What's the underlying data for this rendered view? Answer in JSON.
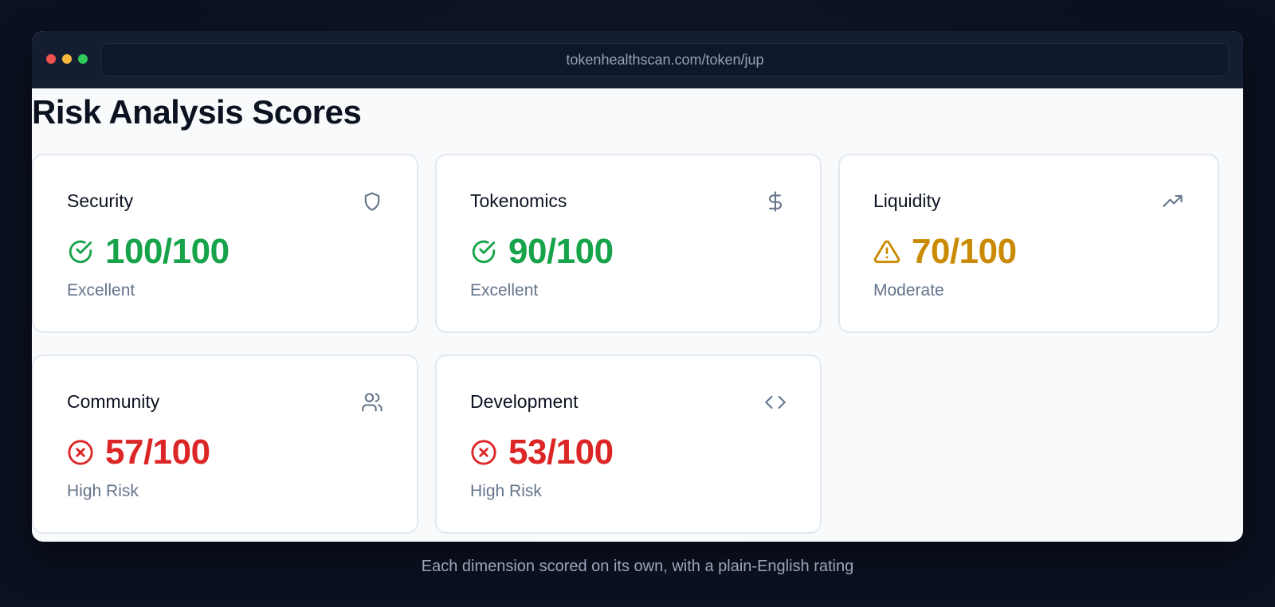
{
  "browser": {
    "url": "tokenhealthscan.com/token/jup",
    "dots": [
      "#ef4444",
      "#f59e0b",
      "#22c55e"
    ]
  },
  "page": {
    "title": "Risk Analysis Scores"
  },
  "colors": {
    "good": "#16a34a",
    "moderate": "#ca8a04",
    "risk": "#dc2626",
    "icon": "#64748b"
  },
  "cards": [
    {
      "title": "Security",
      "score": "100/100",
      "rating": "Excellent",
      "icon": "shield-icon",
      "status": "good"
    },
    {
      "title": "Tokenomics",
      "score": "90/100",
      "rating": "Excellent",
      "icon": "dollar-icon",
      "status": "good"
    },
    {
      "title": "Liquidity",
      "score": "70/100",
      "rating": "Moderate",
      "icon": "trending-up-icon",
      "status": "moderate"
    },
    {
      "title": "Community",
      "score": "57/100",
      "rating": "High Risk",
      "icon": "users-icon",
      "status": "risk"
    },
    {
      "title": "Development",
      "score": "53/100",
      "rating": "High Risk",
      "icon": "code-icon",
      "status": "risk"
    }
  ],
  "caption": "Each dimension scored on its own, with a plain-English rating"
}
